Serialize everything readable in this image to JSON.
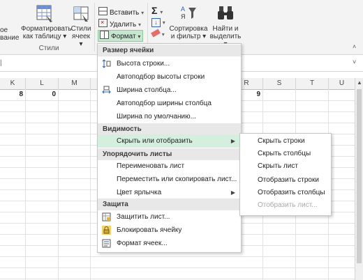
{
  "ribbon": {
    "styles_group": {
      "cond_format_partial": "ое",
      "cond_format_line2_partial": "вание",
      "format_table_line1": "Форматировать",
      "format_table_line2": "как таблицу",
      "cell_styles_line1": "Стили",
      "cell_styles_line2": "ячеек",
      "group_label": "Стили"
    },
    "cells_group": {
      "insert": "Вставить",
      "delete": "Удалить",
      "format": "Формат"
    },
    "editing_group": {
      "sort_line1": "Сортировка",
      "sort_line2": "и фильтр",
      "find_line1": "Найти и",
      "find_line2": "выделить"
    }
  },
  "grid": {
    "columns_left": [
      "K",
      "L",
      "M"
    ],
    "columns_right": [
      "R",
      "S",
      "T",
      "U"
    ],
    "values": {
      "K": "8",
      "L": "0",
      "R": "9"
    }
  },
  "format_menu": {
    "sections": [
      {
        "title": "Размер ячейки",
        "items": [
          {
            "label": "Высота строки...",
            "icon": "row-height-icon"
          },
          {
            "label": "Автоподбор высоты строки"
          },
          {
            "label": "Ширина столбца...",
            "icon": "column-width-icon"
          },
          {
            "label": "Автоподбор ширины столбца"
          },
          {
            "label": "Ширина по умолчанию..."
          }
        ]
      },
      {
        "title": "Видимость",
        "items": [
          {
            "label": "Скрыть или отобразить",
            "submenu": true,
            "highlighted": true
          }
        ]
      },
      {
        "title": "Упорядочить листы",
        "items": [
          {
            "label": "Переименовать лист"
          },
          {
            "label": "Переместить или скопировать лист..."
          },
          {
            "label": "Цвет ярлычка",
            "submenu": true
          }
        ]
      },
      {
        "title": "Защита",
        "items": [
          {
            "label": "Защитить лист...",
            "icon": "protect-sheet-icon"
          },
          {
            "label": "Блокировать ячейку",
            "icon": "lock-icon"
          },
          {
            "label": "Формат ячеек...",
            "icon": "format-cells-icon"
          }
        ]
      }
    ]
  },
  "submenu": {
    "items": [
      {
        "label": "Скрыть строки"
      },
      {
        "label": "Скрыть столбцы"
      },
      {
        "label": "Скрыть лист"
      },
      {
        "label": "Отобразить строки"
      },
      {
        "label": "Отобразить столбцы"
      },
      {
        "label": "Отобразить лист...",
        "disabled": true
      }
    ]
  },
  "colors": {
    "highlight": "#d5efdf",
    "accent": "#217346",
    "format_button": "#c5e6cf"
  }
}
